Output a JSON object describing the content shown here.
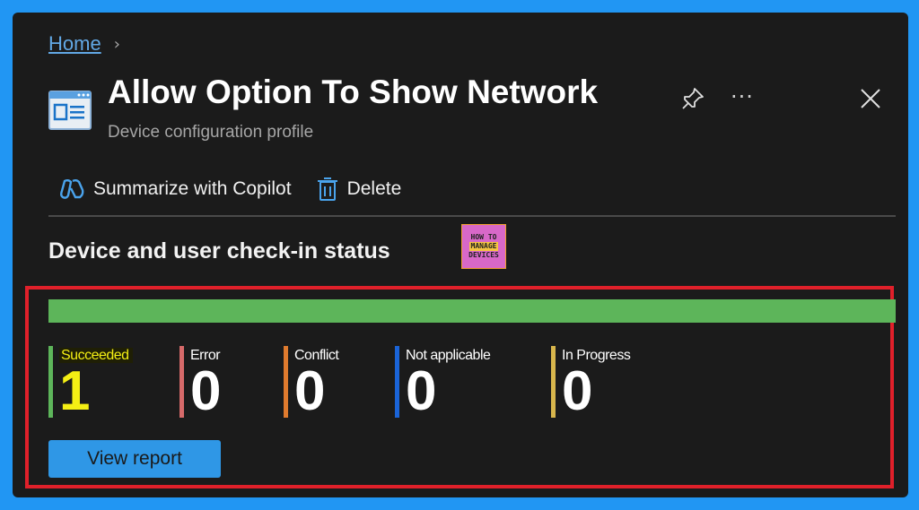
{
  "breadcrumb": {
    "home": "Home",
    "separator": "›"
  },
  "header": {
    "title": "Allow Option To Show Network",
    "subtitle": "Device configuration profile",
    "icon": "profile-icon",
    "pin_icon": "pin-icon",
    "more_label": "···",
    "close_icon": "close-icon"
  },
  "toolbar": {
    "copilot_label": "Summarize with Copilot",
    "copilot_icon": "copilot-icon",
    "delete_label": "Delete",
    "delete_icon": "trash-icon"
  },
  "section": {
    "title": "Device and user check-in status"
  },
  "watermark": {
    "line1": "HOW TO",
    "line2": "MANAGE",
    "line3": "DEVICES"
  },
  "progress": {
    "succeeded_fraction": 1.0,
    "color": "#5db55a"
  },
  "stats": [
    {
      "label": "Succeeded",
      "value": "1",
      "color": "#5db55a"
    },
    {
      "label": "Error",
      "value": "0",
      "color": "#d66a6a"
    },
    {
      "label": "Conflict",
      "value": "0",
      "color": "#e07b2e"
    },
    {
      "label": "Not applicable",
      "value": "0",
      "color": "#1a64d8"
    },
    {
      "label": "In Progress",
      "value": "0",
      "color": "#d8b64c"
    }
  ],
  "actions": {
    "view_report": "View report"
  },
  "colors": {
    "background": "#2196f3",
    "panel": "#1b1b1b",
    "highlight_border": "#e0202a",
    "button": "#2f97e6"
  }
}
